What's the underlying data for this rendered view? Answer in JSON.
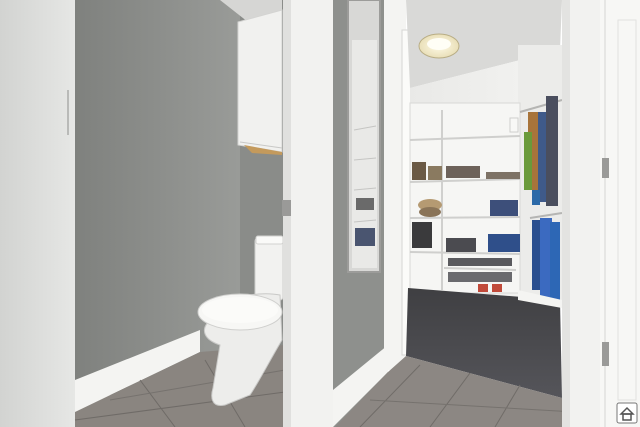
{
  "scene": {
    "kind": "interior-photo",
    "rooms": [
      "toilet-room",
      "walk-in-closet"
    ],
    "colors": {
      "wall_gray": "#8f918e",
      "wall_light": "#e4e5e3",
      "trim_white": "#f3f3f1",
      "tile": "#8a8580",
      "carpet": "#4a4a4c",
      "ceiling": "#d9d9d7"
    },
    "icons": [
      "ceiling-light-icon",
      "watermark-house-icon"
    ]
  }
}
